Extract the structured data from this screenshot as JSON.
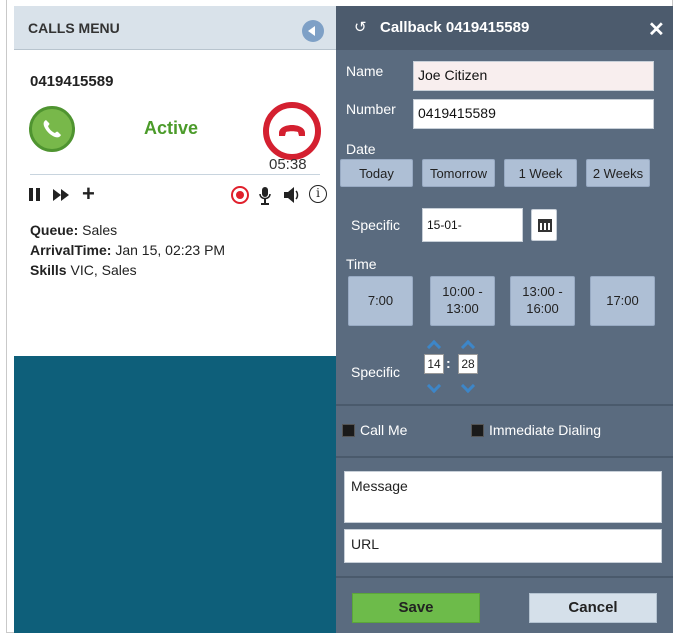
{
  "calls_menu": {
    "title": "CALLS MENU",
    "phone_number": "0419415589",
    "status": "Active",
    "timer": "05:38",
    "details": {
      "queue_label": "Queue:",
      "queue_value": "Sales",
      "arrival_label": "ArrivalTime:",
      "arrival_value": "Jan 15, 02:23 PM",
      "skills_label": "Skills",
      "skills_value": "VIC, Sales"
    }
  },
  "callback": {
    "title": "Callback 0419415589",
    "name_label": "Name",
    "name_value": "Joe Citizen",
    "number_label": "Number",
    "number_value": "0419415589",
    "date_label": "Date",
    "date_buttons": [
      "Today",
      "Tomorrow",
      "1 Week",
      "2 Weeks"
    ],
    "date_specific_label": "Specific",
    "date_specific_value": "15-01-",
    "time_label": "Time",
    "time_buttons": [
      {
        "line1": "7:00",
        "line2": ""
      },
      {
        "line1": "10:00 -",
        "line2": "13:00"
      },
      {
        "line1": "13:00 -",
        "line2": "16:00"
      },
      {
        "line1": "17:00",
        "line2": ""
      }
    ],
    "time_specific_label": "Specific",
    "time_hour": "14",
    "time_separator": ":",
    "time_minute": "28",
    "call_me_label": "Call Me",
    "immediate_label": "Immediate Dialing",
    "message_placeholder": "Message",
    "url_placeholder": "URL",
    "save_label": "Save",
    "cancel_label": "Cancel"
  },
  "colors": {
    "active_green": "#4b9b2a",
    "hangup_red": "#d42030",
    "panel_slate": "#5a6b7f",
    "footer_teal": "#0e5f7a",
    "save_green": "#6dbb4a"
  }
}
